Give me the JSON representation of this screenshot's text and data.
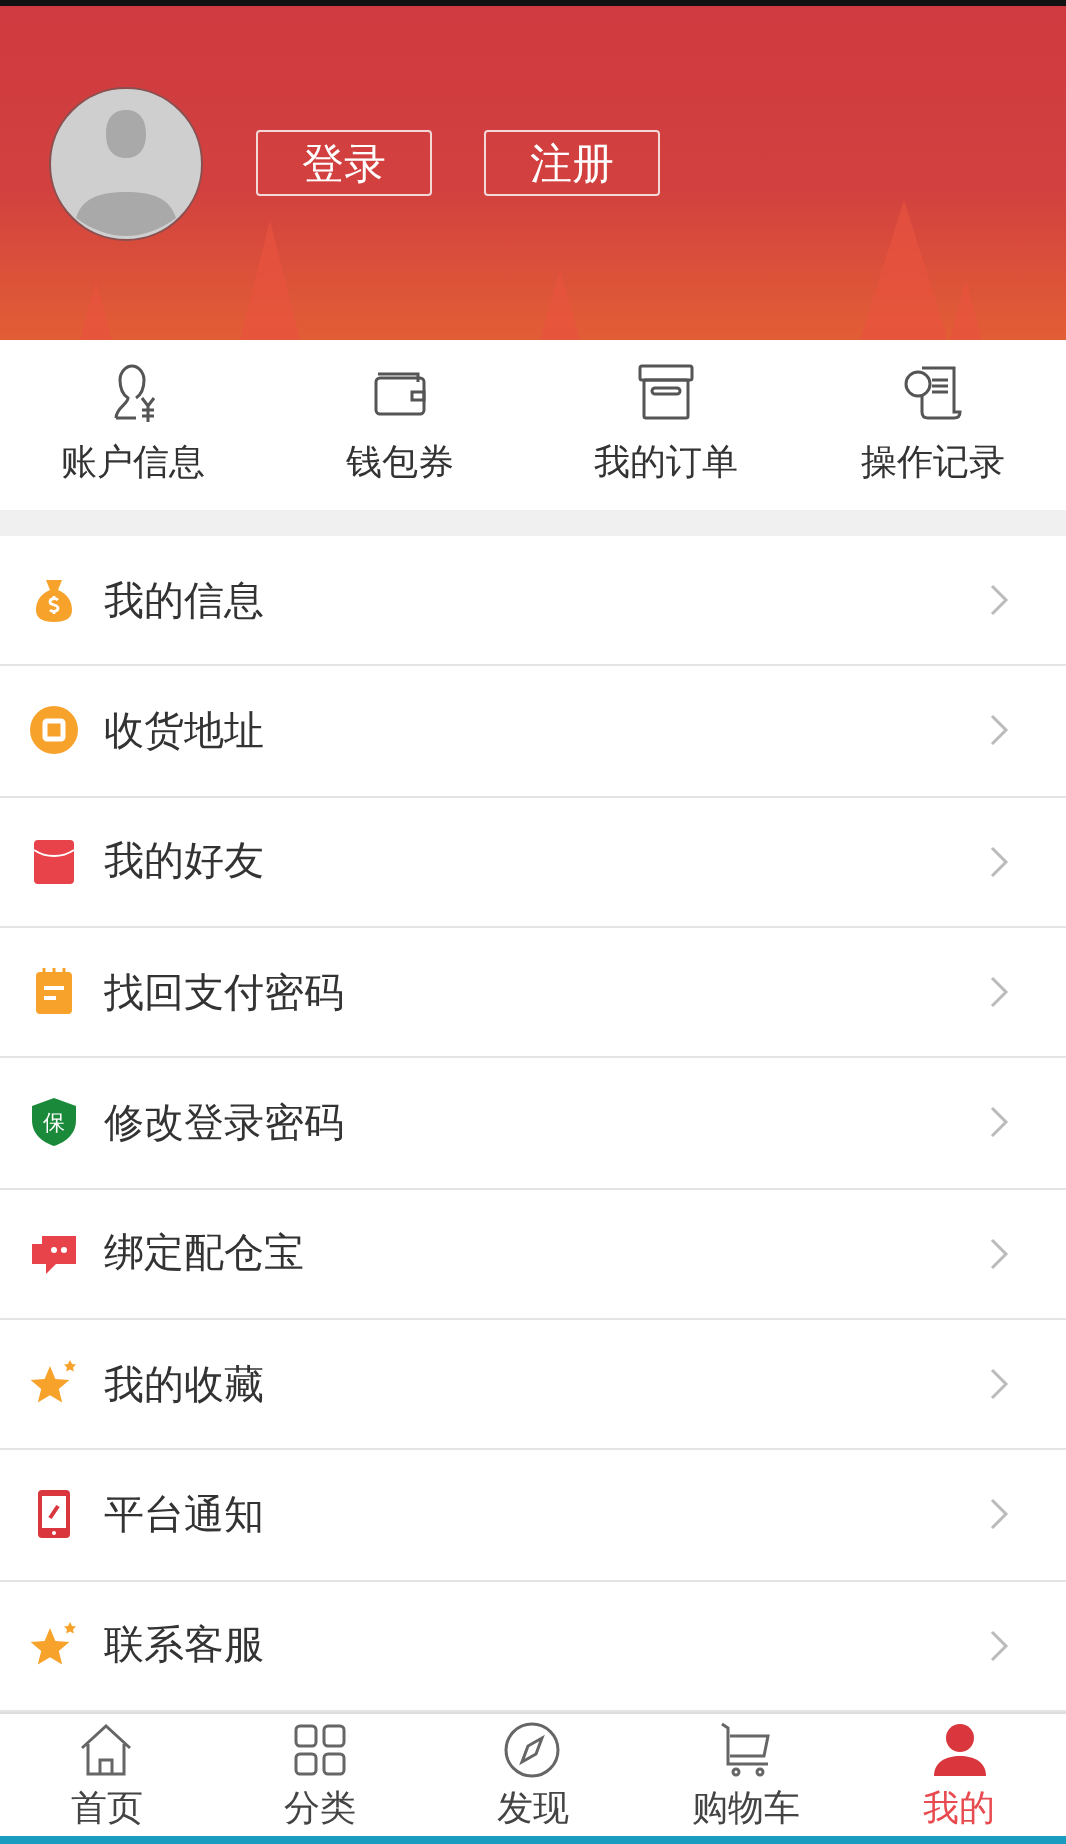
{
  "header": {
    "buttons": [
      "登录",
      "注册"
    ]
  },
  "quick_links": [
    {
      "label": "账户信息",
      "kind": "account"
    },
    {
      "label": "钱包券",
      "kind": "wallet"
    },
    {
      "label": "我的订单",
      "kind": "orders"
    },
    {
      "label": "操作记录",
      "kind": "records"
    }
  ],
  "menu": [
    {
      "label": "我的信息",
      "kind": "moneybag"
    },
    {
      "label": "收货地址",
      "kind": "address"
    },
    {
      "label": "我的好友",
      "kind": "envelope"
    },
    {
      "label": "找回支付密码",
      "kind": "notepad"
    },
    {
      "label": "修改登录密码",
      "kind": "shield",
      "badge": "保"
    },
    {
      "label": "绑定配仓宝",
      "kind": "chat"
    },
    {
      "label": "我的收藏",
      "kind": "star"
    },
    {
      "label": "平台通知",
      "kind": "phone"
    },
    {
      "label": "联系客服",
      "kind": "star"
    }
  ],
  "tab_bar": [
    {
      "label": "首页",
      "kind": "home",
      "selected": false
    },
    {
      "label": "分类",
      "kind": "grid",
      "selected": false
    },
    {
      "label": "发现",
      "kind": "compass",
      "selected": false
    },
    {
      "label": "购物车",
      "kind": "cart",
      "selected": false
    },
    {
      "label": "我的",
      "kind": "person",
      "selected": true
    }
  ]
}
